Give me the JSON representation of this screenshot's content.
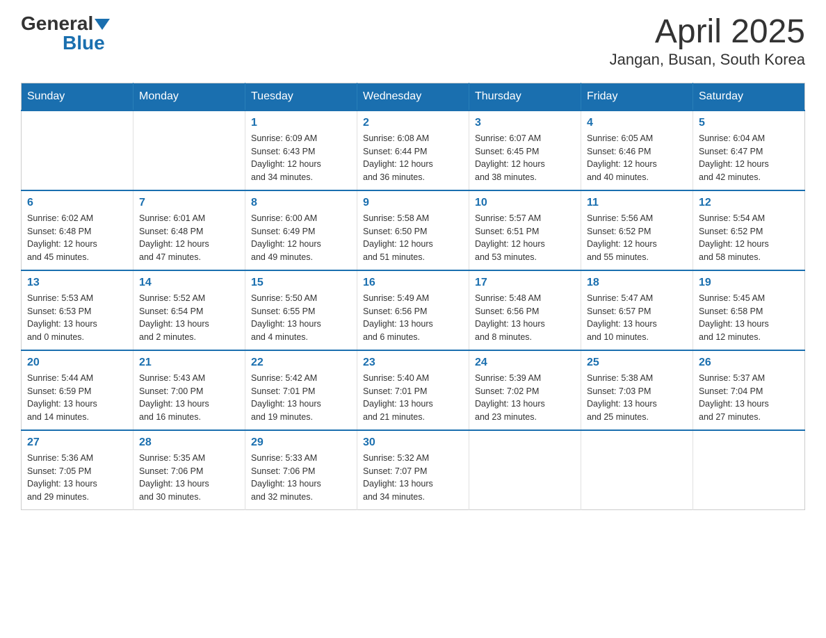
{
  "header": {
    "logo": {
      "general": "General",
      "blue": "Blue",
      "triangle": "▲"
    },
    "title": "April 2025",
    "subtitle": "Jangan, Busan, South Korea"
  },
  "calendar": {
    "days_of_week": [
      "Sunday",
      "Monday",
      "Tuesday",
      "Wednesday",
      "Thursday",
      "Friday",
      "Saturday"
    ],
    "weeks": [
      [
        {
          "day": "",
          "info": ""
        },
        {
          "day": "",
          "info": ""
        },
        {
          "day": "1",
          "info": "Sunrise: 6:09 AM\nSunset: 6:43 PM\nDaylight: 12 hours\nand 34 minutes."
        },
        {
          "day": "2",
          "info": "Sunrise: 6:08 AM\nSunset: 6:44 PM\nDaylight: 12 hours\nand 36 minutes."
        },
        {
          "day": "3",
          "info": "Sunrise: 6:07 AM\nSunset: 6:45 PM\nDaylight: 12 hours\nand 38 minutes."
        },
        {
          "day": "4",
          "info": "Sunrise: 6:05 AM\nSunset: 6:46 PM\nDaylight: 12 hours\nand 40 minutes."
        },
        {
          "day": "5",
          "info": "Sunrise: 6:04 AM\nSunset: 6:47 PM\nDaylight: 12 hours\nand 42 minutes."
        }
      ],
      [
        {
          "day": "6",
          "info": "Sunrise: 6:02 AM\nSunset: 6:48 PM\nDaylight: 12 hours\nand 45 minutes."
        },
        {
          "day": "7",
          "info": "Sunrise: 6:01 AM\nSunset: 6:48 PM\nDaylight: 12 hours\nand 47 minutes."
        },
        {
          "day": "8",
          "info": "Sunrise: 6:00 AM\nSunset: 6:49 PM\nDaylight: 12 hours\nand 49 minutes."
        },
        {
          "day": "9",
          "info": "Sunrise: 5:58 AM\nSunset: 6:50 PM\nDaylight: 12 hours\nand 51 minutes."
        },
        {
          "day": "10",
          "info": "Sunrise: 5:57 AM\nSunset: 6:51 PM\nDaylight: 12 hours\nand 53 minutes."
        },
        {
          "day": "11",
          "info": "Sunrise: 5:56 AM\nSunset: 6:52 PM\nDaylight: 12 hours\nand 55 minutes."
        },
        {
          "day": "12",
          "info": "Sunrise: 5:54 AM\nSunset: 6:52 PM\nDaylight: 12 hours\nand 58 minutes."
        }
      ],
      [
        {
          "day": "13",
          "info": "Sunrise: 5:53 AM\nSunset: 6:53 PM\nDaylight: 13 hours\nand 0 minutes."
        },
        {
          "day": "14",
          "info": "Sunrise: 5:52 AM\nSunset: 6:54 PM\nDaylight: 13 hours\nand 2 minutes."
        },
        {
          "day": "15",
          "info": "Sunrise: 5:50 AM\nSunset: 6:55 PM\nDaylight: 13 hours\nand 4 minutes."
        },
        {
          "day": "16",
          "info": "Sunrise: 5:49 AM\nSunset: 6:56 PM\nDaylight: 13 hours\nand 6 minutes."
        },
        {
          "day": "17",
          "info": "Sunrise: 5:48 AM\nSunset: 6:56 PM\nDaylight: 13 hours\nand 8 minutes."
        },
        {
          "day": "18",
          "info": "Sunrise: 5:47 AM\nSunset: 6:57 PM\nDaylight: 13 hours\nand 10 minutes."
        },
        {
          "day": "19",
          "info": "Sunrise: 5:45 AM\nSunset: 6:58 PM\nDaylight: 13 hours\nand 12 minutes."
        }
      ],
      [
        {
          "day": "20",
          "info": "Sunrise: 5:44 AM\nSunset: 6:59 PM\nDaylight: 13 hours\nand 14 minutes."
        },
        {
          "day": "21",
          "info": "Sunrise: 5:43 AM\nSunset: 7:00 PM\nDaylight: 13 hours\nand 16 minutes."
        },
        {
          "day": "22",
          "info": "Sunrise: 5:42 AM\nSunset: 7:01 PM\nDaylight: 13 hours\nand 19 minutes."
        },
        {
          "day": "23",
          "info": "Sunrise: 5:40 AM\nSunset: 7:01 PM\nDaylight: 13 hours\nand 21 minutes."
        },
        {
          "day": "24",
          "info": "Sunrise: 5:39 AM\nSunset: 7:02 PM\nDaylight: 13 hours\nand 23 minutes."
        },
        {
          "day": "25",
          "info": "Sunrise: 5:38 AM\nSunset: 7:03 PM\nDaylight: 13 hours\nand 25 minutes."
        },
        {
          "day": "26",
          "info": "Sunrise: 5:37 AM\nSunset: 7:04 PM\nDaylight: 13 hours\nand 27 minutes."
        }
      ],
      [
        {
          "day": "27",
          "info": "Sunrise: 5:36 AM\nSunset: 7:05 PM\nDaylight: 13 hours\nand 29 minutes."
        },
        {
          "day": "28",
          "info": "Sunrise: 5:35 AM\nSunset: 7:06 PM\nDaylight: 13 hours\nand 30 minutes."
        },
        {
          "day": "29",
          "info": "Sunrise: 5:33 AM\nSunset: 7:06 PM\nDaylight: 13 hours\nand 32 minutes."
        },
        {
          "day": "30",
          "info": "Sunrise: 5:32 AM\nSunset: 7:07 PM\nDaylight: 13 hours\nand 34 minutes."
        },
        {
          "day": "",
          "info": ""
        },
        {
          "day": "",
          "info": ""
        },
        {
          "day": "",
          "info": ""
        }
      ]
    ]
  }
}
